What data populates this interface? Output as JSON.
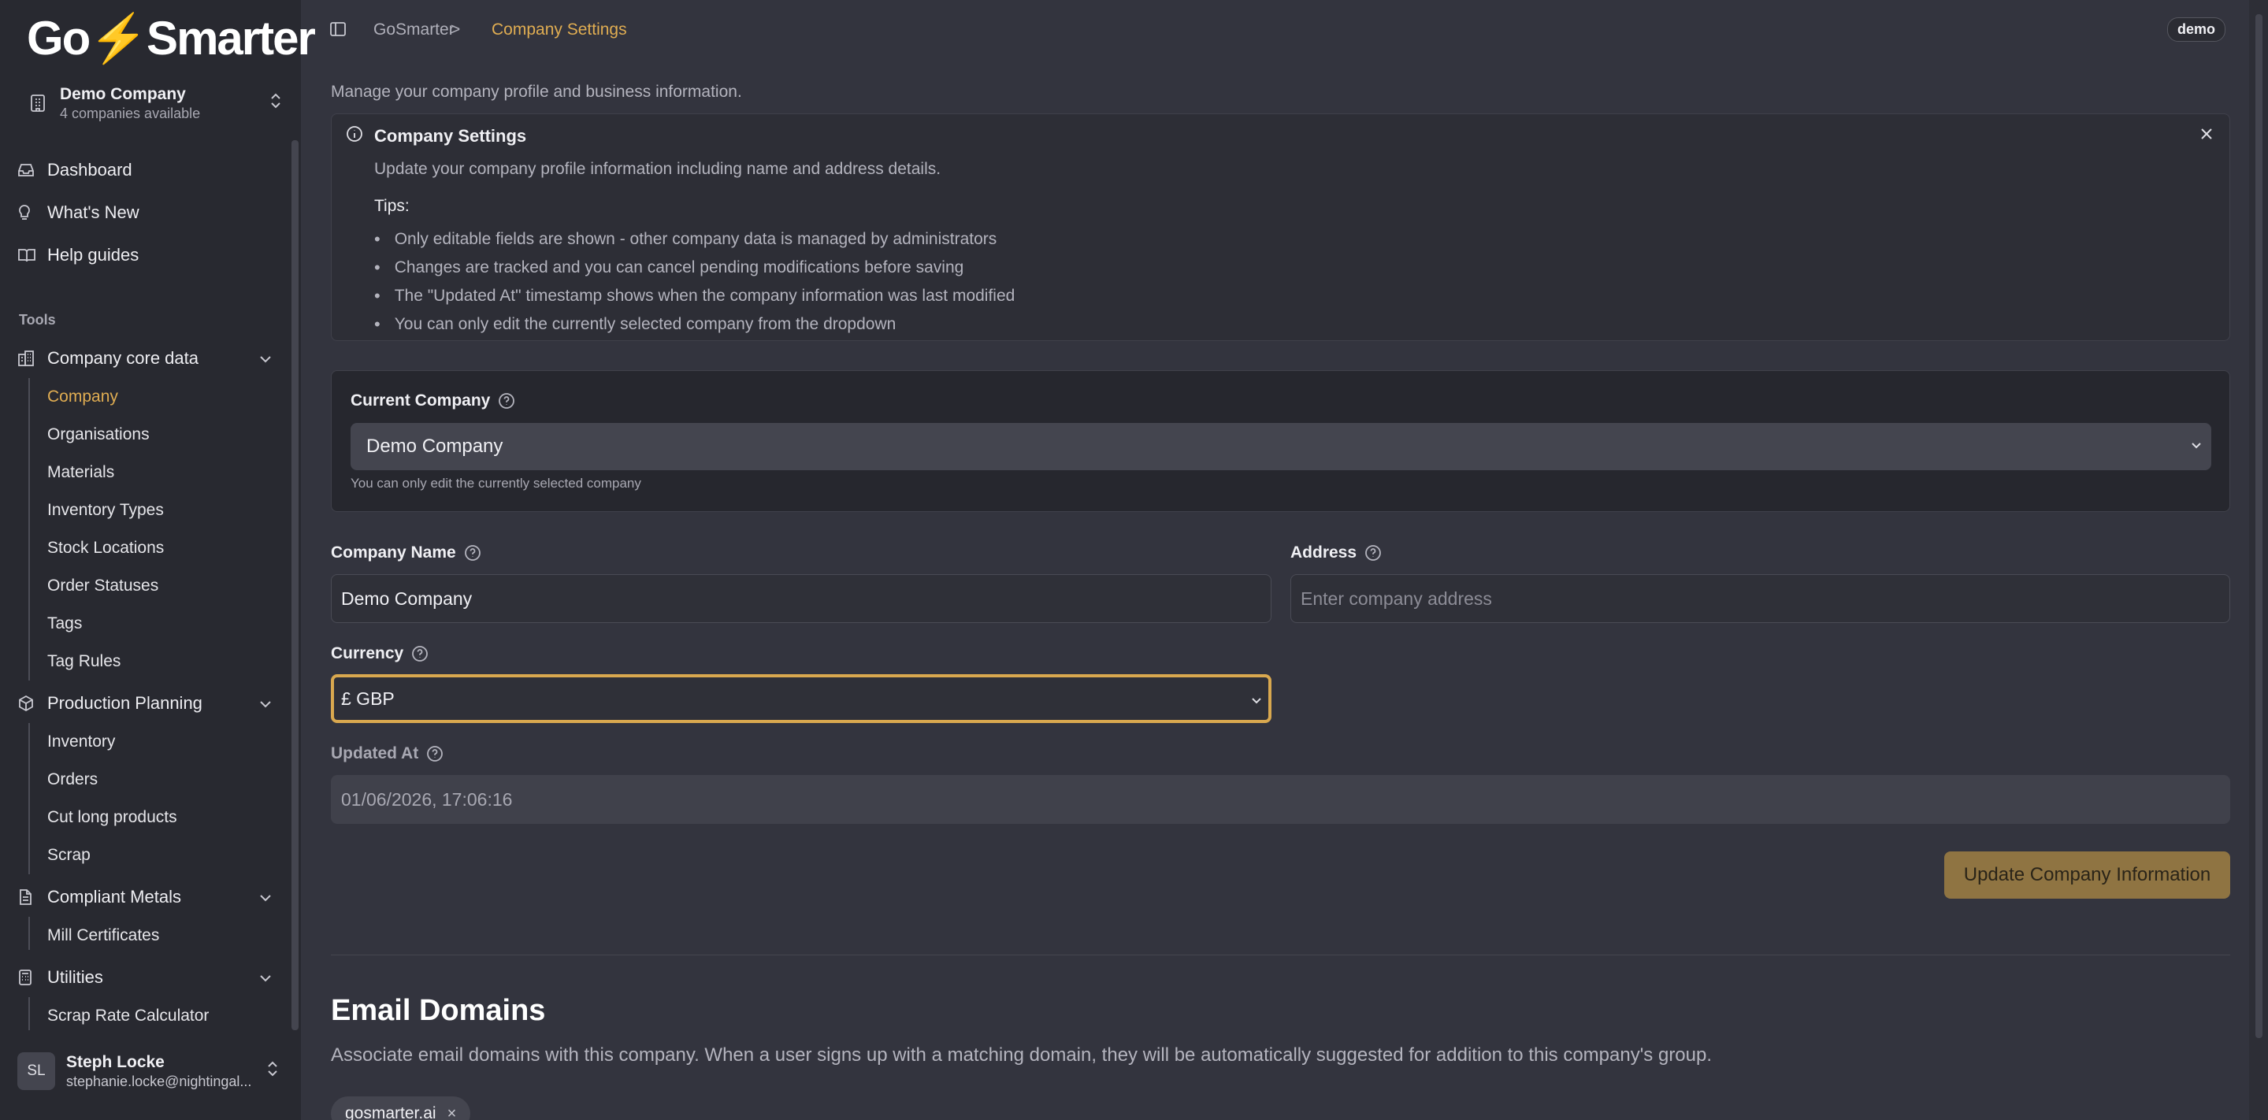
{
  "brand": {
    "logo_text_1": "Go",
    "logo_bolt": "⚡",
    "logo_text_2": "Smarter"
  },
  "company_switcher": {
    "name": "Demo Company",
    "subtitle": "4 companies available"
  },
  "nav": {
    "dashboard": "Dashboard",
    "whats_new": "What's New",
    "help_guides": "Help guides",
    "tools_label": "Tools"
  },
  "groups": {
    "core": {
      "label": "Company core data",
      "items": [
        "Company",
        "Organisations",
        "Materials",
        "Inventory Types",
        "Stock Locations",
        "Order Statuses",
        "Tags",
        "Tag Rules"
      ]
    },
    "production": {
      "label": "Production Planning",
      "items": [
        "Inventory",
        "Orders",
        "Cut long products",
        "Scrap"
      ]
    },
    "metals": {
      "label": "Compliant Metals",
      "items": [
        "Mill Certificates"
      ]
    },
    "utilities": {
      "label": "Utilities",
      "items": [
        "Scrap Rate Calculator"
      ]
    }
  },
  "user": {
    "initials": "SL",
    "name": "Steph Locke",
    "email": "stephanie.locke@nightingal..."
  },
  "breadcrumb": {
    "root": "GoSmarter",
    "separator": ">",
    "current": "Company Settings"
  },
  "env_badge": "demo",
  "intro": "Manage your company profile and business information.",
  "info": {
    "title": "Company Settings",
    "description": "Update your company profile information including name and address details.",
    "tips_label": "Tips:",
    "tips": [
      "Only editable fields are shown - other company data is managed by administrators",
      "Changes are tracked and you can cancel pending modifications before saving",
      "The \"Updated At\" timestamp shows when the company information was last modified",
      "You can only edit the currently selected company from the dropdown"
    ]
  },
  "current_company": {
    "label": "Current Company",
    "value": "Demo Company",
    "hint": "You can only edit the currently selected company"
  },
  "form": {
    "company_name_label": "Company Name",
    "company_name_value": "Demo Company",
    "address_label": "Address",
    "address_placeholder": "Enter company address",
    "currency_label": "Currency",
    "currency_value": "£ GBP",
    "updated_at_label": "Updated At",
    "updated_at_value": "01/06/2026, 17:06:16",
    "submit_label": "Update Company Information"
  },
  "email_domains": {
    "title": "Email Domains",
    "description": "Associate email domains with this company. When a user signs up with a matching domain, they will be automatically suggested for addition to this company's group.",
    "chips": [
      "gosmarter.ai"
    ],
    "chip_remove": "×"
  },
  "colors": {
    "accent": "#e0ad52",
    "button": "#8f7442",
    "background": "#33343e",
    "sidebar": "#282930"
  }
}
